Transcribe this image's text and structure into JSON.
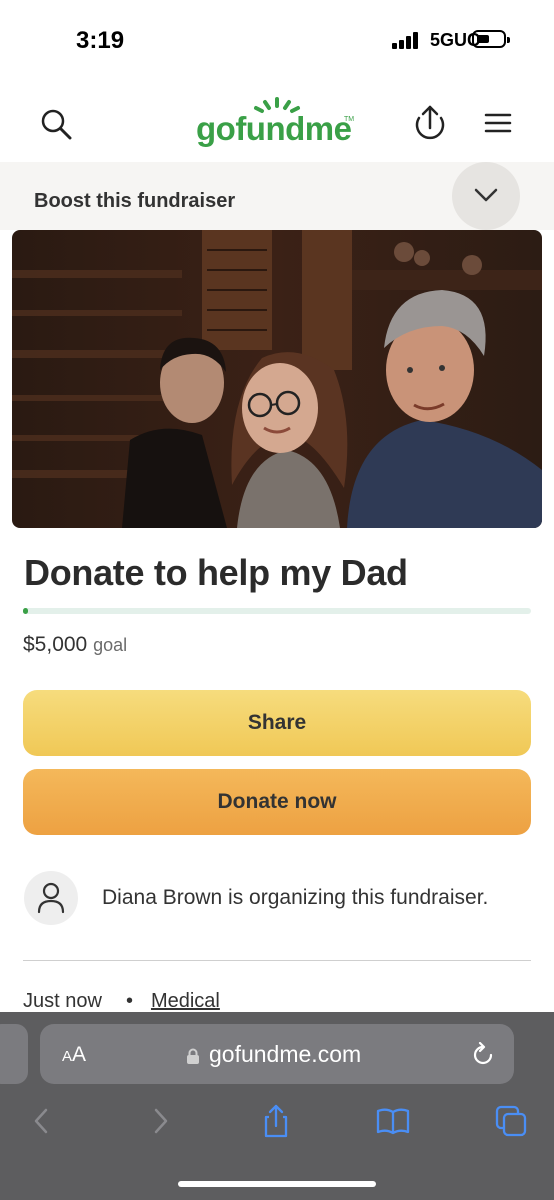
{
  "status_bar": {
    "time": "3:19",
    "network": "5GUC"
  },
  "header": {
    "logo_text": "gofundme",
    "logo_tm": "TM"
  },
  "boost": {
    "label": "Boost this fundraiser"
  },
  "campaign": {
    "title": "Donate to help my Dad",
    "goal_amount": "$5,000",
    "goal_word": "goal",
    "progress_fraction": 0.01
  },
  "actions": {
    "share_label": "Share",
    "donate_label": "Donate now"
  },
  "organizer": {
    "text": "Diana Brown is organizing this fundraiser."
  },
  "meta": {
    "time": "Just now",
    "separator": "•",
    "category": "Medical"
  },
  "browser": {
    "aa_small": "A",
    "aa_large": "A",
    "url": "gofundme.com"
  },
  "colors": {
    "brand_green": "#3aa047",
    "share_yellow": "#f0c856",
    "donate_orange": "#eda142"
  }
}
